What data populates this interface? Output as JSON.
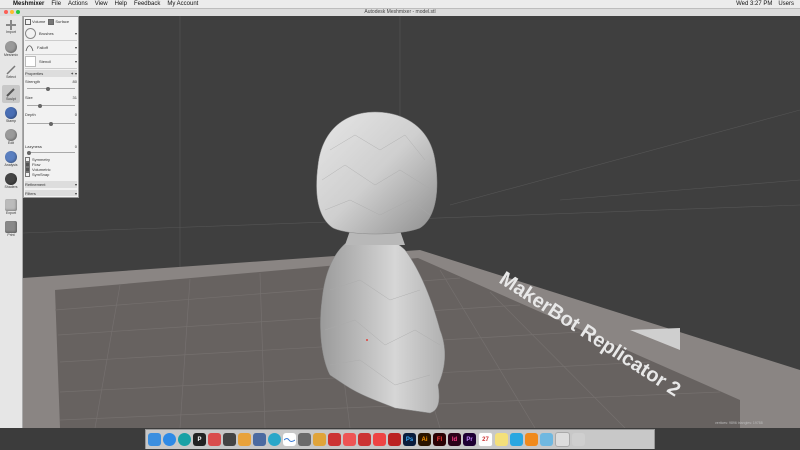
{
  "menubar": {
    "app_name": "Meshmixer",
    "items": [
      "File",
      "Actions",
      "View",
      "Help",
      "Feedback",
      "My Account"
    ],
    "clock": "Wed 3:27 PM",
    "user": "Users"
  },
  "window": {
    "title": "Autodesk Meshmixer - model.stl"
  },
  "toolbar": {
    "items": [
      {
        "label": "Import"
      },
      {
        "label": "Meshmix"
      },
      {
        "label": "Select"
      },
      {
        "label": "Sculpt"
      },
      {
        "label": "Stamp"
      },
      {
        "label": "Edit"
      },
      {
        "label": "Analysis"
      },
      {
        "label": "Shaders"
      },
      {
        "label": "Export"
      },
      {
        "label": "Print"
      }
    ]
  },
  "sculpt_panel": {
    "mode_volume": "Volume",
    "mode_surface": "Surface",
    "brushes_label": "Brushes",
    "falloff_label": "Falloff",
    "stencil_label": "Stencil",
    "properties_label": "Properties",
    "strength_label": "Strength",
    "strength_value": "80",
    "size_label": "Size",
    "size_value": "31",
    "depth_label": "Depth",
    "depth_value": "0",
    "lazyness_label": "Lazyness",
    "lazyness_value": "0",
    "symmetry_label": "Symmetry",
    "flow_label": "Flow",
    "volumetric_label": "Volumetric",
    "symmetry2_label": "SymSnap",
    "refinement_label": "Refinement",
    "filters_label": "Filters"
  },
  "viewport": {
    "bed_label": "MakerBot Replicator 2",
    "status_text": "vertices: 9896 triangles: 19788"
  },
  "dock": {
    "items": [
      "Finder",
      "Safari",
      "Chrome",
      "P",
      "Photos",
      "Inkscape",
      "Blender",
      "Cura",
      "Sketch",
      "Wave",
      "Lines",
      "Mail",
      "Slides",
      "Red",
      "Acrobat",
      "Ps",
      "Ai",
      "Fl",
      "Id",
      "Pr",
      "Calendar",
      "Notes",
      "VLC",
      "Cone",
      "Finder2",
      "Preview",
      "Trash"
    ]
  },
  "colors": {
    "viewport_bg": "#3f3f3f",
    "bed": "#676260",
    "model": "#c9c9c9",
    "accent_red": "#e0443e"
  }
}
